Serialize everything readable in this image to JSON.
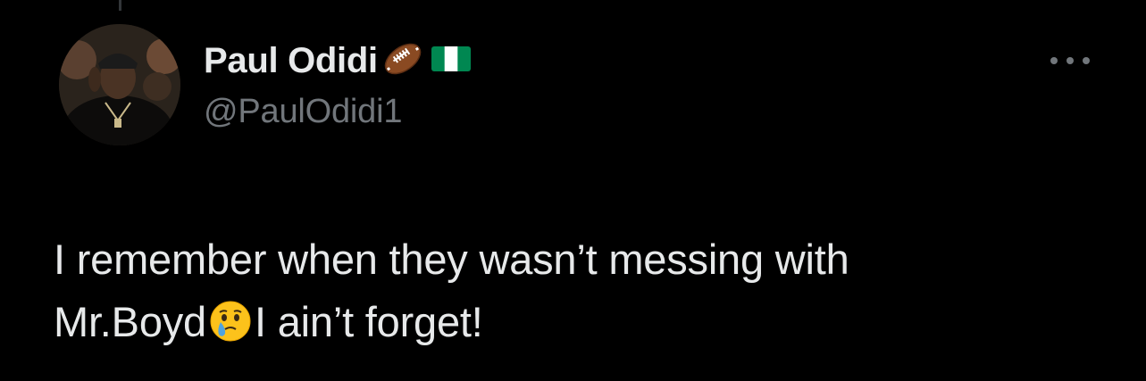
{
  "tweet": {
    "author": {
      "display_name": "Paul Odidi",
      "handle": "@PaulOdidi1",
      "name_emojis": [
        "american-football-emoji",
        "nigeria-flag-emoji"
      ],
      "avatar": "profile-photo"
    },
    "more_menu_icon": "ellipsis-icon",
    "text_line1": "I remember when they wasn’t messing with",
    "text_line2_part1": "Mr.Boyd",
    "text_line2_emoji": "face-holding-back-tears-emoji",
    "text_line2_part2": "I ain’t forget!"
  },
  "colors": {
    "background": "#000000",
    "primary_text": "#e7e9ea",
    "secondary_text": "#71767b"
  }
}
